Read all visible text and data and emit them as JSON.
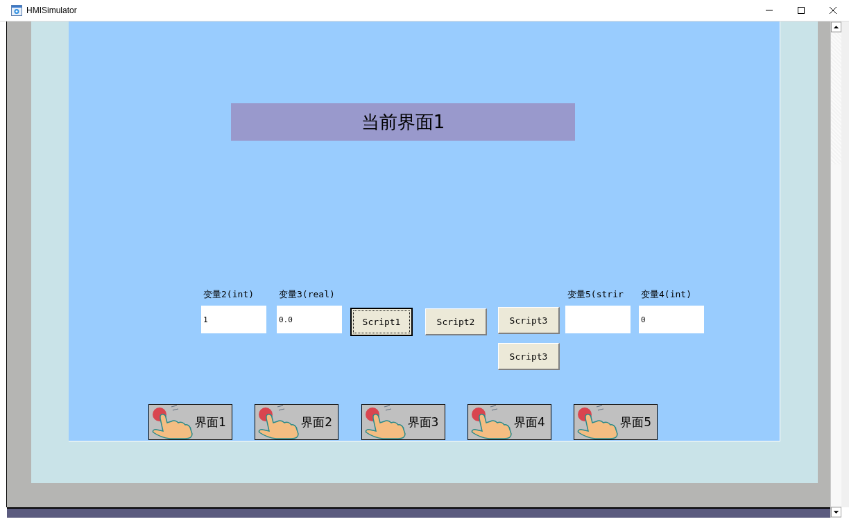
{
  "window": {
    "title": "HMISimulator"
  },
  "screen": {
    "title": "当前界面1",
    "variables": [
      {
        "label": "变量2(int)",
        "value": "1"
      },
      {
        "label": "变量3(real)",
        "value": "0.0"
      },
      {
        "label": "变量5(strir"
      },
      {
        "label": "变量4(int)",
        "value": "0"
      }
    ],
    "buttons": [
      {
        "label": "Script1",
        "focused": true
      },
      {
        "label": "Script2",
        "focused": false
      },
      {
        "label": "Script3",
        "focused": false
      },
      {
        "label": "Script3",
        "focused": false
      }
    ],
    "nav_buttons": [
      {
        "label": "界面1"
      },
      {
        "label": "界面2"
      },
      {
        "label": "界面3"
      },
      {
        "label": "界面4"
      },
      {
        "label": "界面5"
      }
    ]
  }
}
